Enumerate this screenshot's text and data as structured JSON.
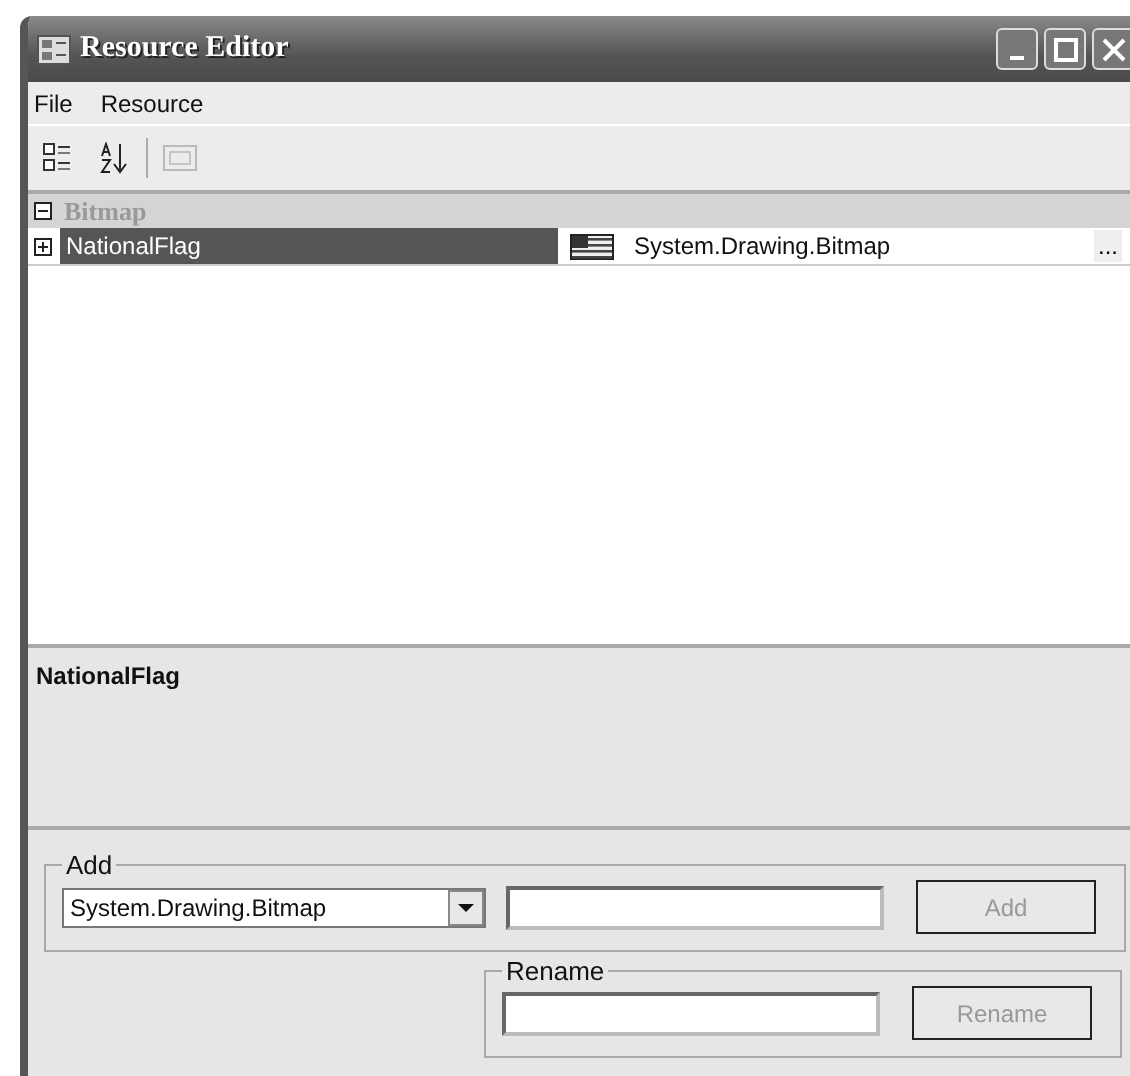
{
  "window": {
    "title": "Resource Editor"
  },
  "menu": [
    "File",
    "Resource"
  ],
  "toolbar": [
    {
      "kind": "categorized",
      "disabled": false
    },
    {
      "kind": "alphabetical",
      "disabled": false
    },
    {
      "kind": "pages",
      "disabled": true
    }
  ],
  "grid": {
    "categories": [
      {
        "name": "Bitmap",
        "expanded": true,
        "properties": [
          {
            "name": "NationalFlag",
            "value": "System.Drawing.Bitmap",
            "expanded": false,
            "selected": true,
            "button": "..."
          }
        ]
      }
    ]
  },
  "description": {
    "title": "NationalFlag"
  },
  "add_group": {
    "legend": "Add",
    "type_value": "System.Drawing.Bitmap",
    "button": "Add",
    "button_disabled": true
  },
  "rename_group": {
    "legend": "Rename",
    "button": "Rename",
    "button_disabled": true
  }
}
